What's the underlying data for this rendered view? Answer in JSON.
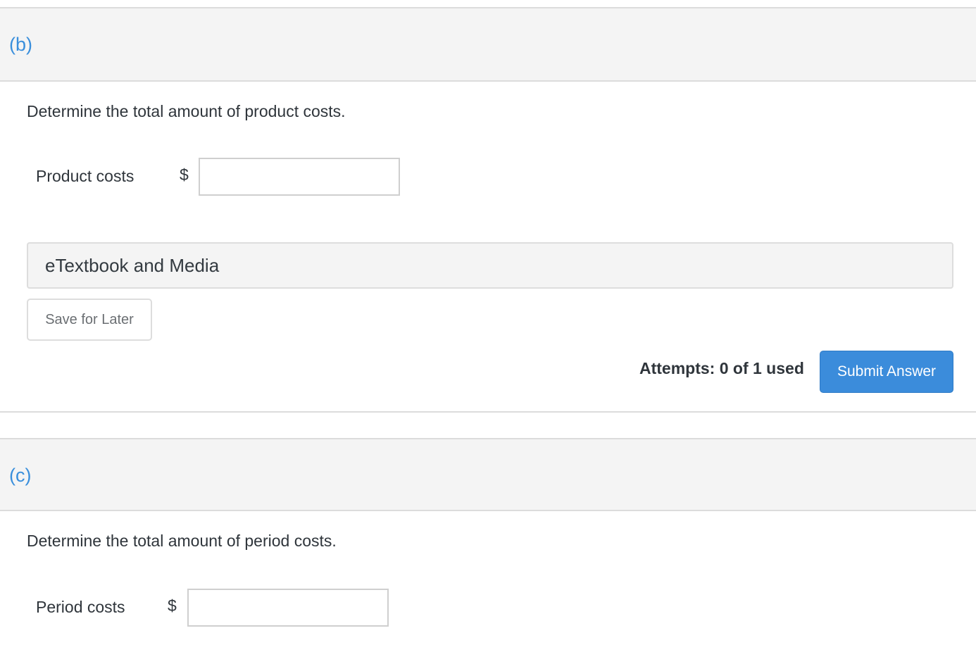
{
  "parts": [
    {
      "letter": "(b)",
      "prompt": "Determine the total amount of product costs.",
      "field_label": "Product costs",
      "currency": "$",
      "value": "",
      "placeholder": ""
    },
    {
      "letter": "(c)",
      "prompt": "Determine the total amount of period costs.",
      "field_label": "Period costs",
      "currency": "$",
      "value": "",
      "placeholder": ""
    }
  ],
  "media": {
    "label": "eTextbook and Media"
  },
  "actions": {
    "save_label": "Save for Later",
    "attempts_text": "Attempts: 0 of 1 used",
    "submit_label": "Submit Answer"
  },
  "colors": {
    "accent": "#3b8cdb",
    "section_letter": "#3a8fdc",
    "header_bg": "#f4f4f4"
  }
}
